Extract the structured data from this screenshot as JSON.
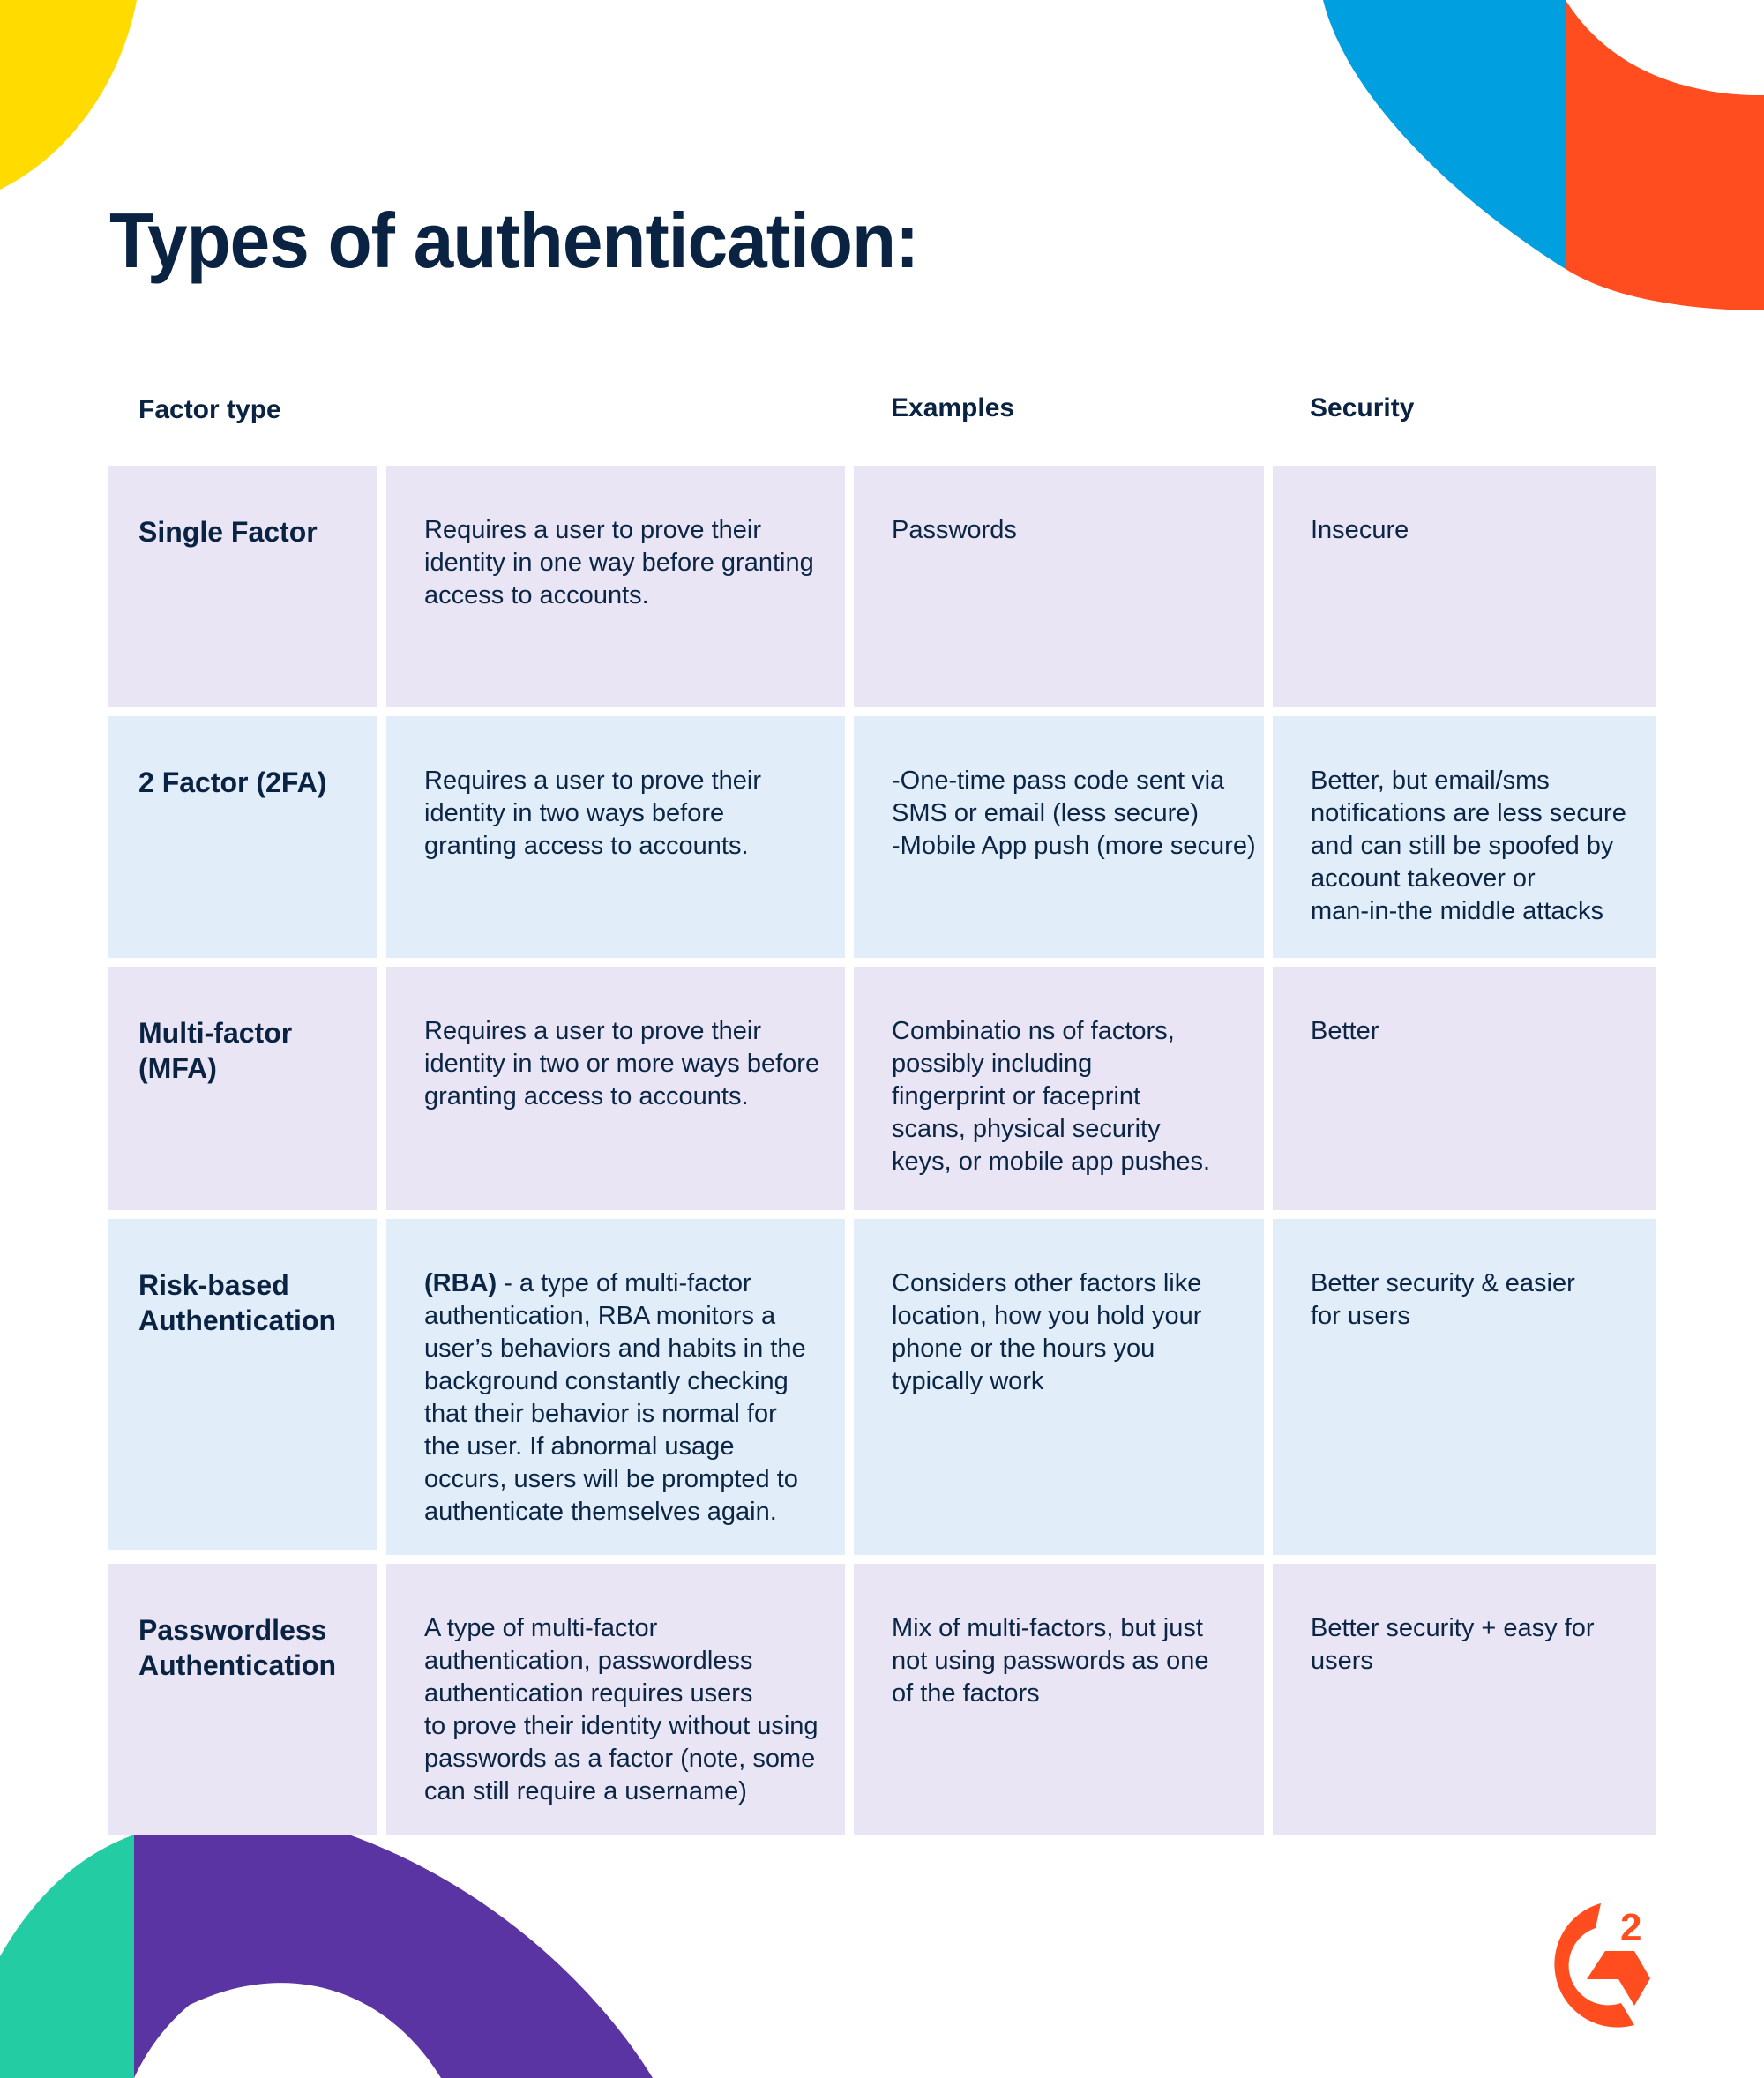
{
  "title": "Types of authentication:",
  "headers": {
    "factor_type": "Factor type",
    "examples": "Examples",
    "security": "Security"
  },
  "colors": {
    "heading": "#0a2342",
    "row_purple": "#e9e5f4",
    "row_blue": "#e1edf9",
    "deco_yellow": "#ffdb00",
    "deco_blue": "#00a0e0",
    "deco_orange": "#ff4d1f",
    "deco_green": "#23cca2",
    "deco_purple": "#5a34a2",
    "brand_logo": "#ff4d1f"
  },
  "rows": [
    {
      "factor": [
        "Single Factor"
      ],
      "description": [
        "Requires a user to prove their",
        "identity in one way before granting",
        "access to accounts."
      ],
      "examples": [
        "Passwords"
      ],
      "security": [
        "Insecure"
      ]
    },
    {
      "factor": [
        "2 Factor (2FA)"
      ],
      "description": [
        "Requires a user to prove their",
        "identity in two ways before",
        "granting access to accounts."
      ],
      "examples": [
        "-One-time pass code sent via",
        "SMS or email (less secure)",
        "-Mobile App push (more secure)"
      ],
      "security": [
        "Better, but email/sms",
        "notifications are less secure",
        "and can still be spoofed by",
        "account takeover or",
        "man-in-the middle attacks"
      ]
    },
    {
      "factor": [
        "Multi-factor",
        "(MFA)"
      ],
      "description": [
        "Requires a user to prove their",
        "identity in two or more ways before",
        "granting access to accounts."
      ],
      "examples": [
        "Combinatio ns of factors,",
        "possibly including",
        "fingerprint or faceprint",
        "scans, physical security",
        "keys, or mobile app pushes."
      ],
      "security": [
        "Better"
      ]
    },
    {
      "factor": [
        "Risk-based",
        "Authentication"
      ],
      "description_bold_prefix": "(RBA)",
      "description": [
        " - a type of multi-factor",
        "authentication, RBA monitors a",
        "user’s behaviors and habits in the",
        "background constantly checking",
        "that their behavior is normal for",
        "the user. If abnormal usage",
        "occurs, users will be prompted to",
        "authenticate themselves again."
      ],
      "examples": [
        "Considers other factors like",
        "location, how you hold your",
        "phone or the hours you",
        "typically work"
      ],
      "security": [
        "Better security & easier",
        "for users"
      ]
    },
    {
      "factor": [
        "Passwordless",
        "Authentication"
      ],
      "description": [
        "A type of multi-factor",
        "authentication, passwordless",
        "authentication requires users",
        "to prove their identity without using",
        "passwords as a factor (note, some",
        "can still require a username)"
      ],
      "examples": [
        "Mix of multi-factors, but just",
        "not using passwords as one",
        "of the factors"
      ],
      "security": [
        "Better security + easy for",
        "users"
      ]
    }
  ],
  "logo": {
    "name": "G2",
    "superscript": "2"
  }
}
